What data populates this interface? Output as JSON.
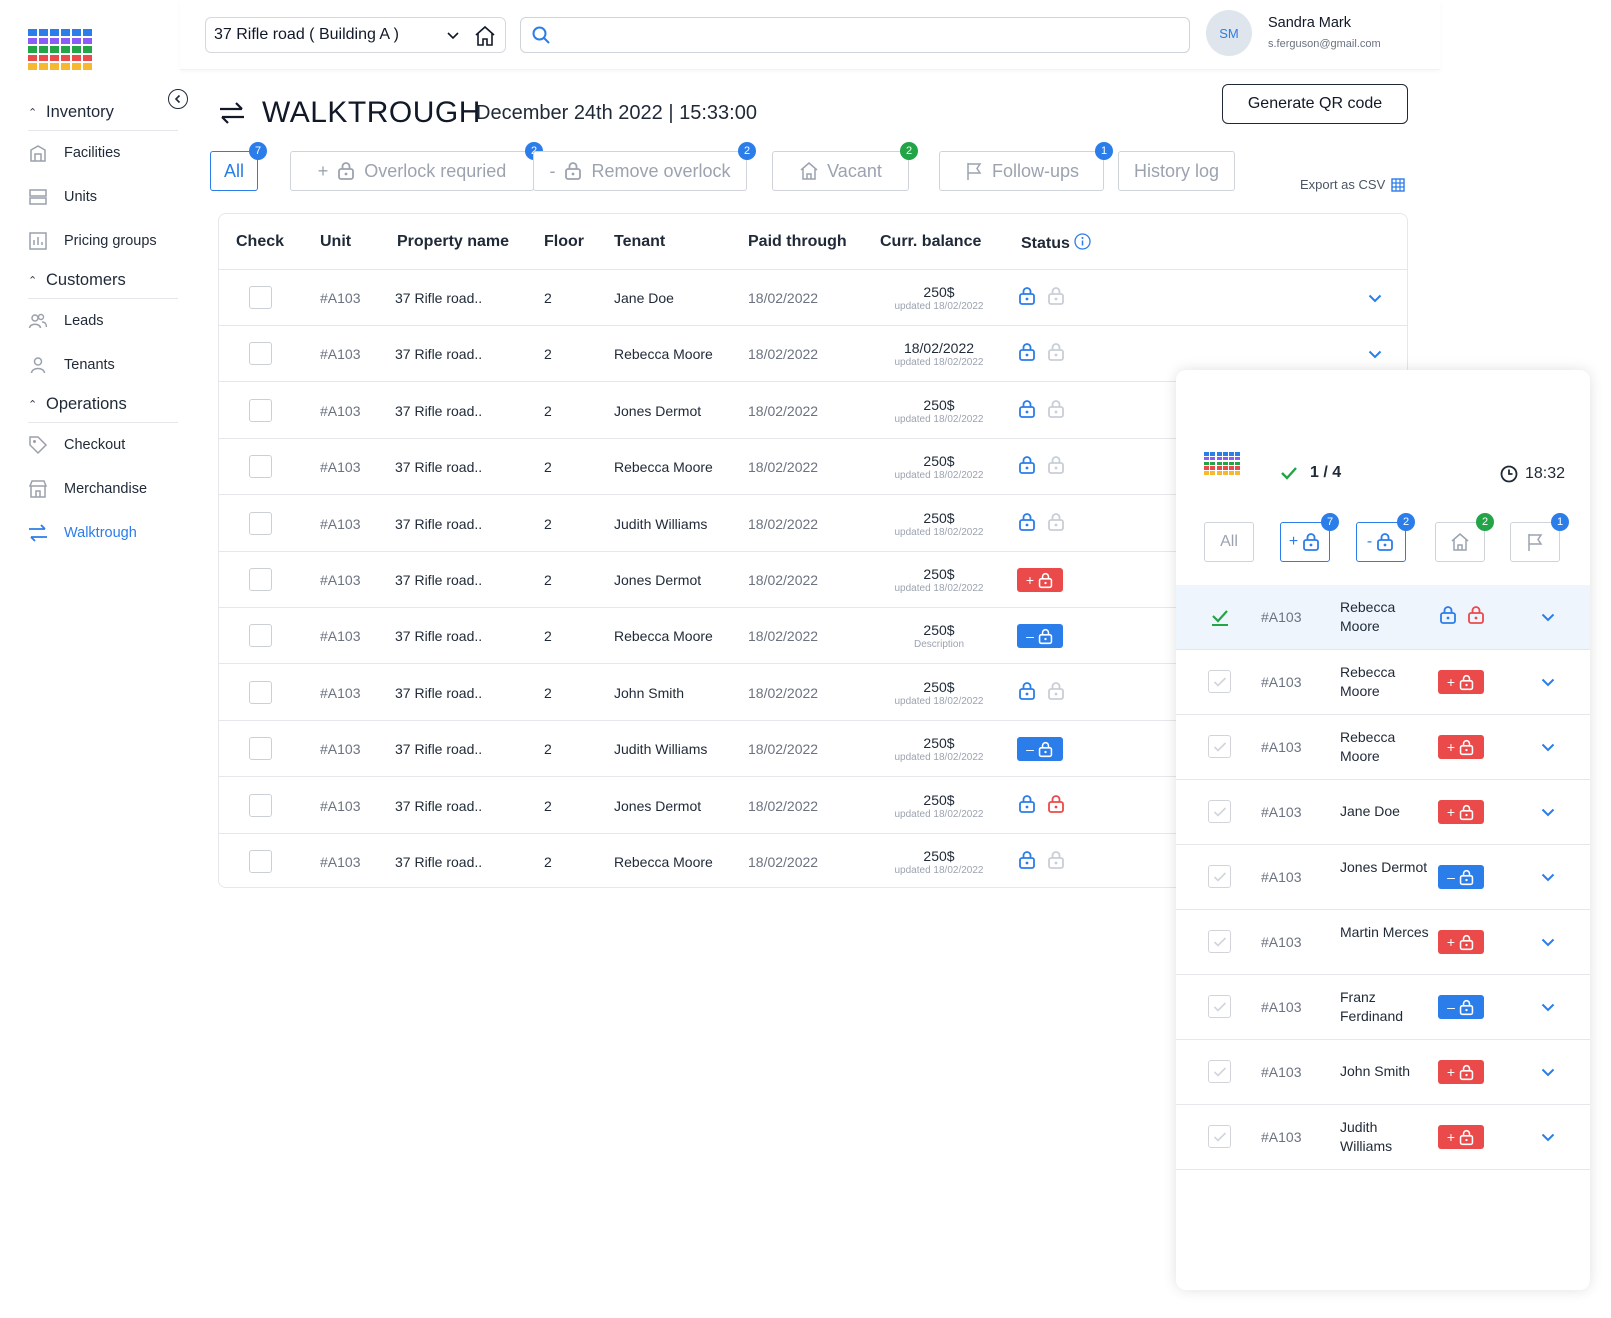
{
  "brand": {
    "colors": [
      "#2b7de9",
      "#2b7de9",
      "#2b7de9",
      "#2b7de9",
      "#2b7de9",
      "#2b7de9",
      "#8b5cf6",
      "#8b5cf6",
      "#8b5cf6",
      "#8b5cf6",
      "#8b5cf6",
      "#8b5cf6",
      "#22a447",
      "#22a447",
      "#22a447",
      "#22a447",
      "#22a447",
      "#22a447",
      "#ea4a4a",
      "#ea4a4a",
      "#ea4a4a",
      "#ea4a4a",
      "#ea4a4a",
      "#ea4a4a",
      "#f5b82e",
      "#f5b82e",
      "#f5b82e",
      "#f5b82e",
      "#f5b82e",
      "#f5b82e"
    ]
  },
  "sidebar": {
    "sections": [
      {
        "title": "Inventory",
        "items": [
          {
            "label": "Facilities",
            "icon": "facility-icon",
            "active": false
          },
          {
            "label": "Units",
            "icon": "units-icon",
            "active": false
          },
          {
            "label": "Pricing groups",
            "icon": "chart-icon",
            "active": false
          }
        ]
      },
      {
        "title": "Customers",
        "items": [
          {
            "label": "Leads",
            "icon": "users-icon",
            "active": false
          },
          {
            "label": "Tenants",
            "icon": "user-icon",
            "active": false
          }
        ]
      },
      {
        "title": "Operations",
        "items": [
          {
            "label": "Checkout",
            "icon": "tag-icon",
            "active": false
          },
          {
            "label": "Merchandise",
            "icon": "store-icon",
            "active": false
          },
          {
            "label": "Walktrough",
            "icon": "swap-icon",
            "active": true
          }
        ]
      }
    ]
  },
  "topbar": {
    "building": "37 Rifle road ( Building A )",
    "search_value": "",
    "user": {
      "initials": "SM",
      "name": "Sandra Mark",
      "email": "s.ferguson@gmail.com"
    }
  },
  "page": {
    "title": "WALKTROUGH",
    "date": "December 24th 2022 | 15:33:00",
    "qr_button": "Generate QR code",
    "export_label": "Export as CSV"
  },
  "filters": [
    {
      "label": "All",
      "badge": "7",
      "badge_color": "blue",
      "active": true
    },
    {
      "label": "Overlock requried",
      "prefix": "+",
      "badge": "2",
      "badge_color": "blue",
      "active": false
    },
    {
      "label": "Remove overlock",
      "prefix": "-",
      "badge": "2",
      "badge_color": "blue",
      "active": false
    },
    {
      "label": "Vacant",
      "badge": "2",
      "badge_color": "green",
      "active": false
    },
    {
      "label": "Follow-ups",
      "badge": "1",
      "badge_color": "blue",
      "active": false
    },
    {
      "label": "History log",
      "badge": "",
      "active": false
    }
  ],
  "table": {
    "columns": [
      "Check",
      "Unit",
      "Property name",
      "Floor",
      "Tenant",
      "Paid through",
      "Curr. balance",
      "Status"
    ],
    "rows": [
      {
        "unit": "#A103",
        "property": "37 Rifle road..",
        "floor": "2",
        "tenant": "Jane Doe",
        "paid": "18/02/2022",
        "balance": "250$",
        "balance_sub": "updated 18/02/2022",
        "status": "lock-pair",
        "chevron": true
      },
      {
        "unit": "#A103",
        "property": "37 Rifle road..",
        "floor": "2",
        "tenant": "Rebecca Moore",
        "paid": "18/02/2022",
        "balance": "18/02/2022",
        "balance_sub": "updated 18/02/2022",
        "status": "lock-pair",
        "chevron": true
      },
      {
        "unit": "#A103",
        "property": "37 Rifle road..",
        "floor": "2",
        "tenant": "Jones Dermot",
        "paid": "18/02/2022",
        "balance": "250$",
        "balance_sub": "updated 18/02/2022",
        "status": "lock-pair",
        "chevron": false
      },
      {
        "unit": "#A103",
        "property": "37 Rifle road..",
        "floor": "2",
        "tenant": "Rebecca Moore",
        "paid": "18/02/2022",
        "balance": "250$",
        "balance_sub": "updated 18/02/2022",
        "status": "lock-pair",
        "chevron": false
      },
      {
        "unit": "#A103",
        "property": "37 Rifle road..",
        "floor": "2",
        "tenant": "Judith Williams",
        "paid": "18/02/2022",
        "balance": "250$",
        "balance_sub": "updated 18/02/2022",
        "status": "lock-pair",
        "chevron": false
      },
      {
        "unit": "#A103",
        "property": "37 Rifle road..",
        "floor": "2",
        "tenant": "Jones Dermot",
        "paid": "18/02/2022",
        "balance": "250$",
        "balance_sub": "updated 18/02/2022",
        "status": "add-overlock",
        "chevron": false
      },
      {
        "unit": "#A103",
        "property": "37 Rifle road..",
        "floor": "2",
        "tenant": "Rebecca Moore",
        "paid": "18/02/2022",
        "balance": "250$",
        "balance_sub": "Description",
        "status": "remove-overlock",
        "chevron": false
      },
      {
        "unit": "#A103",
        "property": "37 Rifle road..",
        "floor": "2",
        "tenant": "John Smith",
        "paid": "18/02/2022",
        "balance": "250$",
        "balance_sub": "updated 18/02/2022",
        "status": "lock-pair",
        "chevron": false
      },
      {
        "unit": "#A103",
        "property": "37 Rifle road..",
        "floor": "2",
        "tenant": "Judith Williams",
        "paid": "18/02/2022",
        "balance": "250$",
        "balance_sub": "updated 18/02/2022",
        "status": "remove-overlock",
        "chevron": false
      },
      {
        "unit": "#A103",
        "property": "37 Rifle road..",
        "floor": "2",
        "tenant": "Jones Dermot",
        "paid": "18/02/2022",
        "balance": "250$",
        "balance_sub": "updated 18/02/2022",
        "status": "lock-pair-red",
        "chevron": false
      },
      {
        "unit": "#A103",
        "property": "37 Rifle road..",
        "floor": "2",
        "tenant": "Rebecca Moore",
        "paid": "18/02/2022",
        "balance": "250$",
        "balance_sub": "updated 18/02/2022",
        "status": "lock-pair",
        "chevron": false
      }
    ]
  },
  "mobile": {
    "progress": "1 / 4",
    "time": "18:32",
    "tabs": [
      {
        "label": "All",
        "kind": "all",
        "badge": ""
      },
      {
        "label": "+",
        "kind": "add",
        "badge": "7",
        "badge_color": "blue"
      },
      {
        "label": "-",
        "kind": "remove",
        "badge": "2",
        "badge_color": "blue"
      },
      {
        "label": "",
        "kind": "vacant",
        "badge": "2",
        "badge_color": "green"
      },
      {
        "label": "",
        "kind": "flag",
        "badge": "1",
        "badge_color": "blue"
      }
    ],
    "rows": [
      {
        "unit": "#A103",
        "name": "Rebecca Moore",
        "status": "lock-pair-red",
        "selected": true
      },
      {
        "unit": "#A103",
        "name": "Rebecca Moore",
        "status": "add-overlock",
        "selected": false
      },
      {
        "unit": "#A103",
        "name": "Rebecca Moore",
        "status": "add-overlock",
        "selected": false
      },
      {
        "unit": "#A103",
        "name": "Jane Doe",
        "status": "add-overlock",
        "selected": false
      },
      {
        "unit": "#A103",
        "name": "Jones Dermot",
        "status": "remove-overlock",
        "selected": false
      },
      {
        "unit": "#A103",
        "name": "Martin Merces",
        "status": "add-overlock",
        "selected": false
      },
      {
        "unit": "#A103",
        "name": "Franz Ferdinand",
        "status": "remove-overlock",
        "selected": false
      },
      {
        "unit": "#A103",
        "name": "John Smith",
        "status": "add-overlock",
        "selected": false
      },
      {
        "unit": "#A103",
        "name": "Judith Williams",
        "status": "add-overlock",
        "selected": false
      }
    ]
  }
}
